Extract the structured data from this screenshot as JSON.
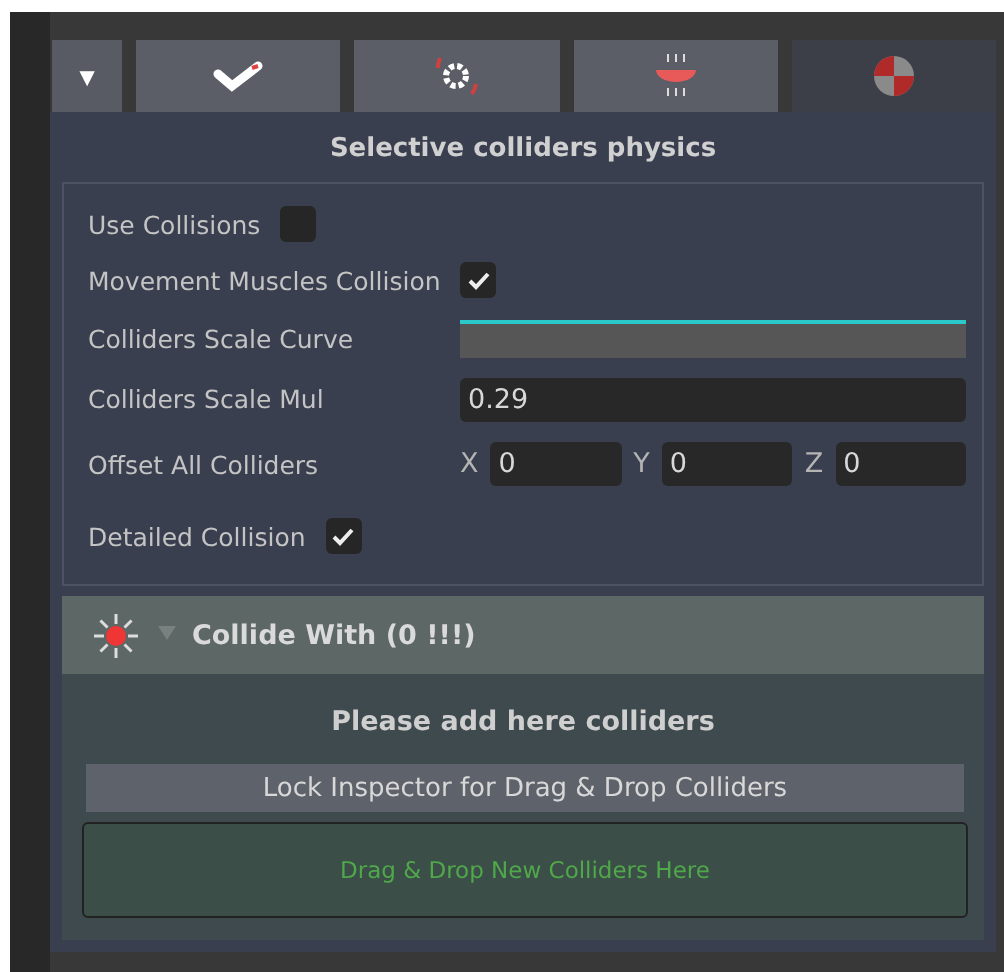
{
  "toolbar": {
    "dropdown": "▼",
    "tabs": [
      {
        "selected": false
      },
      {
        "selected": false
      },
      {
        "selected": false
      },
      {
        "selected": true
      }
    ]
  },
  "section_title": "Selective colliders physics",
  "fields": [
    {
      "kind": "checkbox",
      "label": "Use Collisions",
      "checked": false
    },
    {
      "kind": "checkbox",
      "label": "Movement Muscles Collision",
      "checked": true
    },
    {
      "kind": "curve",
      "label": "Colliders Scale Curve"
    },
    {
      "kind": "number",
      "label": "Colliders Scale Mul",
      "value": "0.29"
    },
    {
      "kind": "vector",
      "label": "Offset All Colliders",
      "components": [
        {
          "axis": "X",
          "value": "0"
        },
        {
          "axis": "Y",
          "value": "0"
        },
        {
          "axis": "Z",
          "value": "0"
        }
      ]
    },
    {
      "kind": "checkbox",
      "label": "Detailed Collision",
      "checked": true
    }
  ],
  "collide_group": {
    "title": "Collide With (0 !!!)",
    "expanded": true,
    "message": "Please add here colliders",
    "lock_button": "Lock Inspector for Drag & Drop Colliders",
    "drop_zone": "Drag & Drop New Colliders Here"
  }
}
